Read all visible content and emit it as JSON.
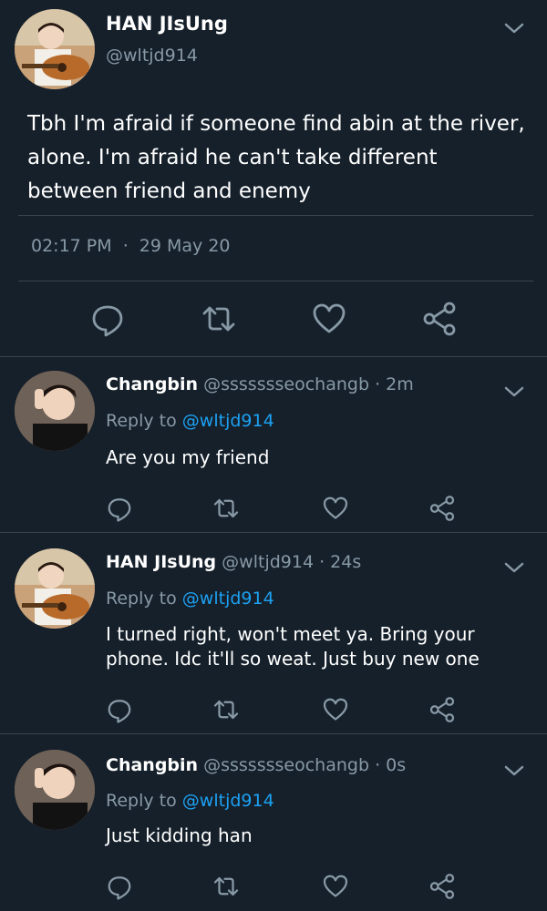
{
  "main_tweet": {
    "author_name": "HAN JIsUng",
    "handle": "@wltjd914",
    "text": "Tbh I'm afraid if someone find abin at the river, alone. I'm afraid he can't take different between friend and enemy",
    "time": "02:17 PM",
    "separator": "·",
    "date": "29 May 20"
  },
  "replies": [
    {
      "author_name": "Changbin",
      "handle": "@ssssssseochangb",
      "time": "· 2m",
      "reply_prefix": "Reply to",
      "reply_to": "@wltjd914",
      "text": "Are you my friend"
    },
    {
      "author_name": "HAN JIsUng",
      "handle": "@wltjd914",
      "time": "· 24s",
      "reply_prefix": "Reply to",
      "reply_to": "@wltjd914",
      "text": "I turned right, won't meet ya. Bring your phone. Idc it'll so weat. Just buy new one"
    },
    {
      "author_name": "Changbin",
      "handle": "@ssssssseochangb",
      "time": "· 0s",
      "reply_prefix": "Reply to",
      "reply_to": "@wltjd914",
      "text": "Just kidding han"
    }
  ],
  "icons": [
    "comment-icon",
    "retweet-icon",
    "like-icon",
    "share-icon",
    "chevron-down-icon"
  ],
  "colors": {
    "background": "#15202b",
    "text": "#ffffff",
    "muted": "#8899a6",
    "link": "#1da1f2",
    "divider": "#38444d"
  }
}
